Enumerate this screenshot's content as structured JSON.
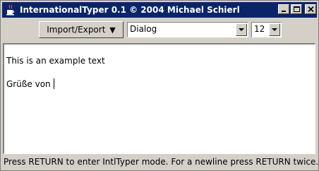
{
  "window": {
    "title": "InternationalTyper 0.1 © 2004 Michael Schierl"
  },
  "toolbar": {
    "import_export_label": "Import/Export",
    "import_export_arrow": "▼",
    "font_select": {
      "selected": "Dialog"
    },
    "size_select": {
      "selected": "12"
    }
  },
  "editor": {
    "lines": [
      "This is an example text",
      "Grüße von "
    ]
  },
  "status": {
    "text": "Press RETURN to enter IntlTyper mode. For a newline press RETURN twice."
  },
  "icons": {
    "app": "java-cup-icon",
    "minimize": "minimize-icon",
    "maximize": "maximize-icon",
    "close": "close-icon",
    "dropdown": "chevron-down-icon"
  },
  "colors": {
    "titlebar": "#0a246a",
    "chrome": "#d4d0c8",
    "editor_bg": "#ffffff"
  }
}
